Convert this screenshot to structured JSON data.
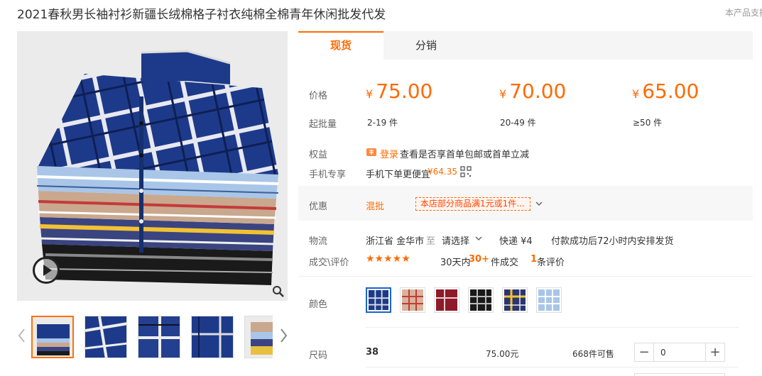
{
  "product": {
    "title": "2021春秋男长袖衬衫新疆长绒棉格子衬衣纯棉全棉青年休闲批发代发",
    "support_text": "本产品支持"
  },
  "tabs": [
    {
      "label": "现货"
    },
    {
      "label": "分销"
    }
  ],
  "pricing": {
    "price_label": "价格",
    "moq_label": "起批量",
    "currency": "¥",
    "tiers": [
      {
        "price": "75.00",
        "range": "2-19 件"
      },
      {
        "price": "70.00",
        "range": "20-49 件"
      },
      {
        "price": "65.00",
        "range": "≥50 件"
      }
    ]
  },
  "benefits": {
    "label": "权益",
    "login_link": "登录",
    "text": "查看是否享首单包邮或首单立减"
  },
  "mobile": {
    "label": "手机专享",
    "text": "手机下单更便宜",
    "price": "¥64.35"
  },
  "promo": {
    "label": "优惠",
    "tag": "混批",
    "coupon_text": "本店部分商品满1元或1件..."
  },
  "logistics": {
    "label": "物流",
    "origin": "浙江省 金华市",
    "to": "至",
    "select": "请选择",
    "express": "快递 ¥4",
    "ship_note": "付款成功后72小时内安排发货"
  },
  "deals": {
    "label": "成交\\评价",
    "stars": "★★★★★",
    "days_text": "30天内",
    "count": "30+",
    "count_suffix": "件成交",
    "reviews": "1",
    "reviews_suffix": "条评价"
  },
  "color": {
    "label": "颜色"
  },
  "size": {
    "label": "尺码",
    "value": "38",
    "price": "75.00元",
    "stock": "668件可售",
    "quantity": "0",
    "minus": "−",
    "plus": "+"
  },
  "colors": {
    "accent": "#ff6a00",
    "selected_border": "#1a64c4"
  }
}
